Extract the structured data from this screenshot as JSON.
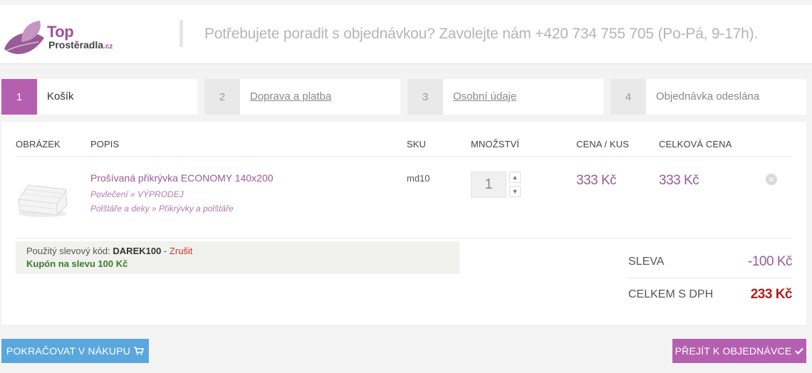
{
  "header": {
    "logo_top": "Top",
    "logo_sub": "Prostěradla",
    "logo_tld": ".cz",
    "contact_text": "Potřebujete poradit s objednávkou? Zavolejte nám +420 734 755 705 (Po-Pá, 9-17h)."
  },
  "steps": [
    {
      "num": "1",
      "label": "Košík",
      "active": true
    },
    {
      "num": "2",
      "label": "Doprava a platba",
      "link": true
    },
    {
      "num": "3",
      "label": "Osobní údaje",
      "link": true
    },
    {
      "num": "4",
      "label": "Objednávka odeslána"
    }
  ],
  "table": {
    "headers": [
      "OBRÁZEK",
      "POPIS",
      "SKU",
      "MNOŽSTVÍ",
      "CENA / KUS",
      "CELKOVÁ CENA"
    ],
    "items": [
      {
        "name": "Prošívaná přikrývka ECONOMY 140x200",
        "category1": "Povlečení » VÝPRODEJ",
        "category2": "Polštáře a deky » Přikrývky a polštáře",
        "sku": "md10",
        "qty": "1",
        "unit_price": "333 Kč",
        "total_price": "333 Kč"
      }
    ]
  },
  "coupon": {
    "label": "Použitý slevový kód:",
    "code": "DAREK100",
    "separator": "-",
    "cancel": "Zrušit",
    "note": "Kupón na slevu 100 Kč"
  },
  "summary": {
    "discount_label": "SLEVA",
    "discount_value": "-100 Kč",
    "total_label": "CELKEM S DPH",
    "total_value": "233 Kč"
  },
  "buttons": {
    "continue": "POKRAČOVAT V NÁKUPU",
    "order": "PŘEJÍT K OBJEDNÁVCE"
  },
  "colors": {
    "accent": "#b55fb0",
    "price": "#9a5a98",
    "total": "#b01e1e",
    "continue_button": "#5aa7dd",
    "coupon_note": "#3d7a2c"
  }
}
